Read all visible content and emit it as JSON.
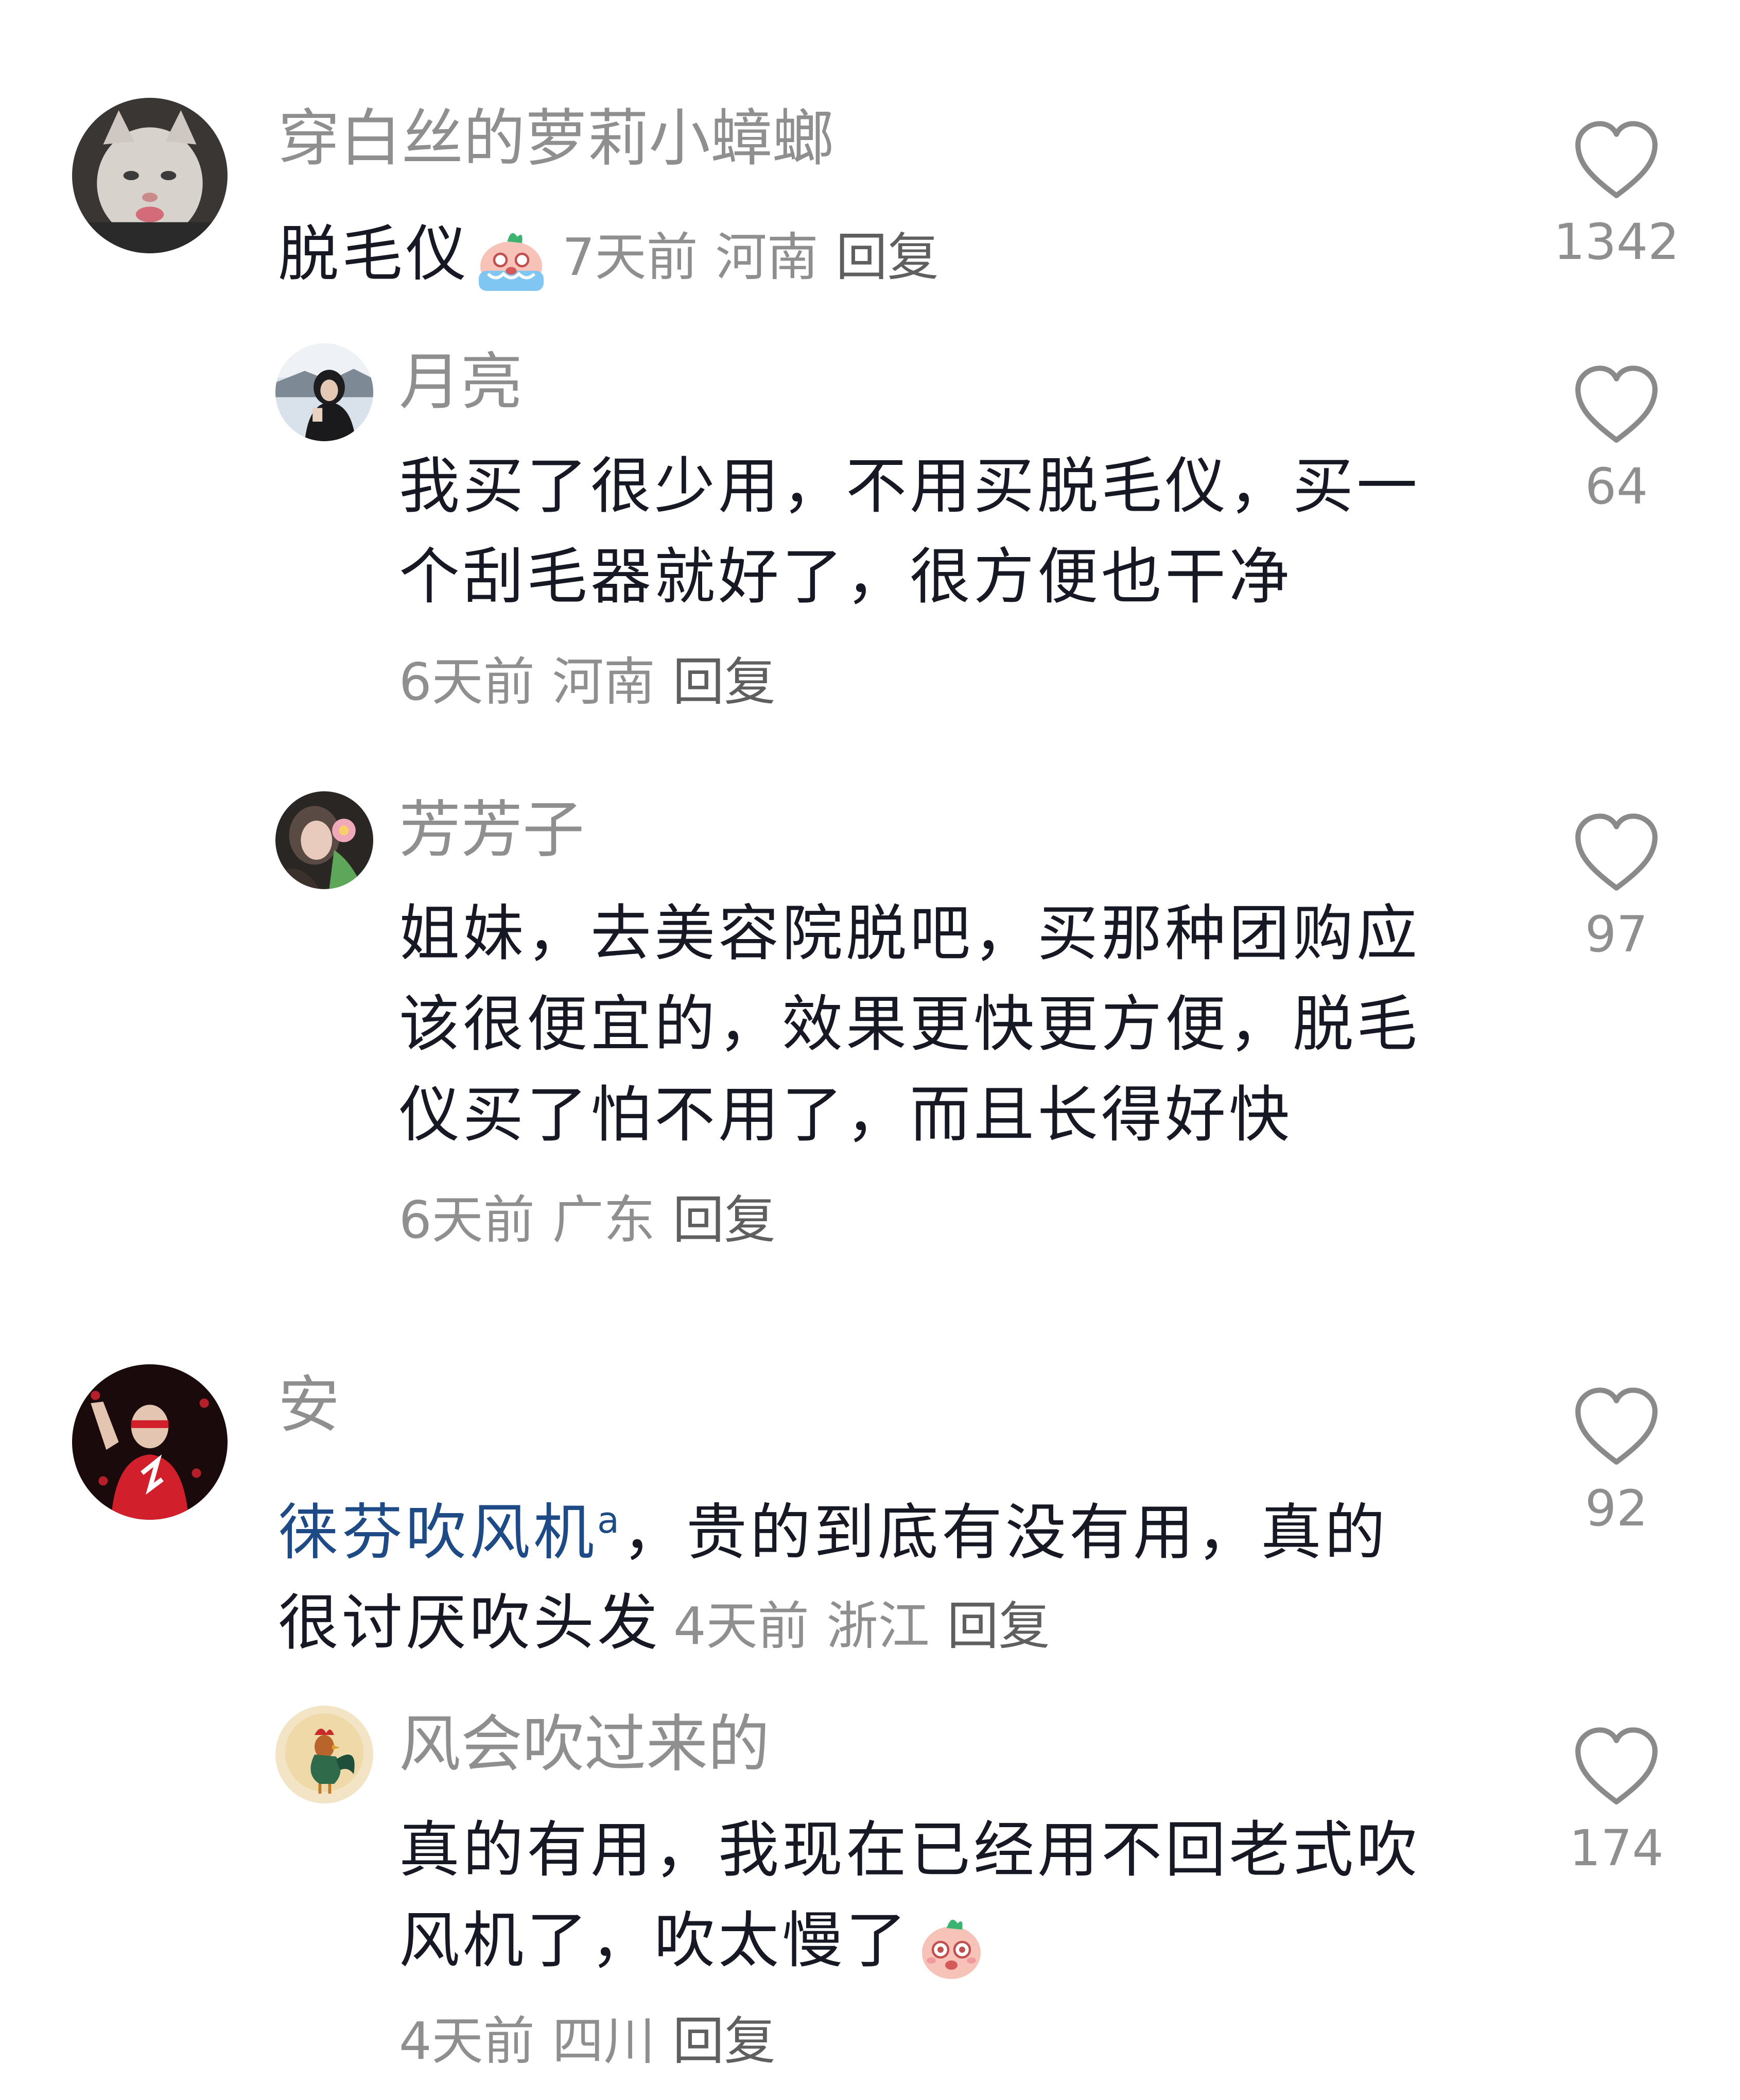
{
  "comments": [
    {
      "username": "穿白丝的萝莉小蟑螂",
      "text": "脱毛仪",
      "time": "7天前",
      "location": "河南",
      "reply_label": "回复",
      "likes": "1342",
      "emoji": "crying-sticker"
    },
    {
      "username": "月亮",
      "text_line1": "我买了很少用，不用买脱毛仪，买一",
      "text_line2": "个刮毛器就好了，很方便也干净",
      "time": "6天前",
      "location": "河南",
      "reply_label": "回复",
      "likes": "64"
    },
    {
      "username": "芳芳子",
      "text_line1": "姐妹，去美容院脱吧，买那种团购应",
      "text_line2": "该很便宜的，效果更快更方便，脱毛",
      "text_line3": "仪买了怕不用了，而且长得好快",
      "time": "6天前",
      "location": "广东",
      "reply_label": "回复",
      "likes": "97"
    },
    {
      "username": "安",
      "mention": "徕芬吹风机",
      "mention_badge": "a",
      "text_line1_rest": "，贵的到底有没有用，真的",
      "text_line2": "很讨厌吹头发",
      "time": "4天前",
      "location": "浙江",
      "reply_label": "回复",
      "likes": "92"
    },
    {
      "username": "风会吹过来的",
      "text_line1": "真的有用，我现在已经用不回老式吹",
      "text_line2": "风机了，吹太慢了",
      "time": "4天前",
      "location": "四川",
      "reply_label": "回复",
      "likes": "174",
      "emoji": "shocked-sticker"
    }
  ],
  "icons": {
    "like": "heart-outline-icon"
  },
  "colors": {
    "username": "#8f8f8f",
    "text": "#161823",
    "mention": "#1e4b86",
    "meta": "#8f8f8f"
  }
}
